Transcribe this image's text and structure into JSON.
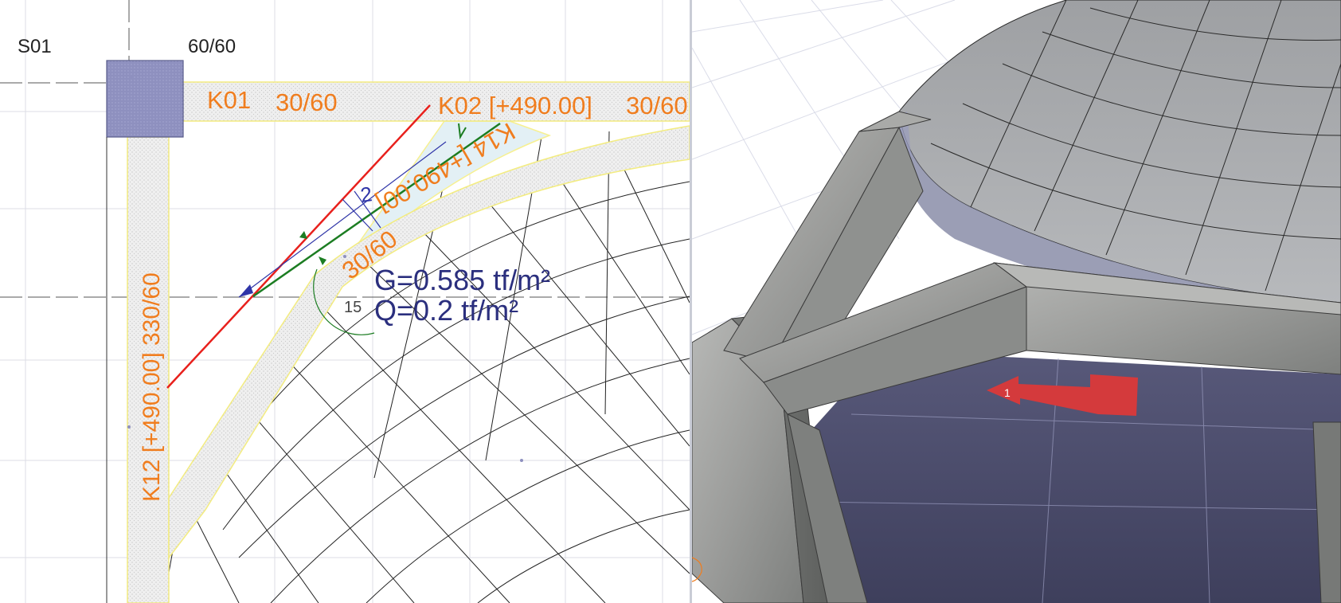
{
  "plan": {
    "column_label": "S01",
    "column_size": "60/60",
    "beams": [
      {
        "name": "K01",
        "size": "30/60"
      },
      {
        "name": "K02 [+490.00]",
        "size": "30/60"
      },
      {
        "name": "K14 [+490.00]",
        "size": "30/60"
      },
      {
        "name": "K12 [+490.00]",
        "size": "30/60"
      }
    ],
    "k12_overlap": "K12 [+490.00] 330/60",
    "dimension_value": "2",
    "angle_value": "15",
    "load": {
      "dead": "G=0.585 tf/m²",
      "live": "Q=0.2 tf/m²"
    }
  },
  "view3d": {
    "arrow_label": "1"
  },
  "colors": {
    "label": "#f07d1e",
    "load_text": "#2b2f7e",
    "column": "#8e90bf",
    "slab_tint": "#e3f0f5",
    "red_line": "#e8201c",
    "green_line": "#1c7d22",
    "blue_line": "#2f35a8",
    "grid": "#d7d9e3",
    "mesh": "#222222",
    "highlight": "#f7f090"
  }
}
